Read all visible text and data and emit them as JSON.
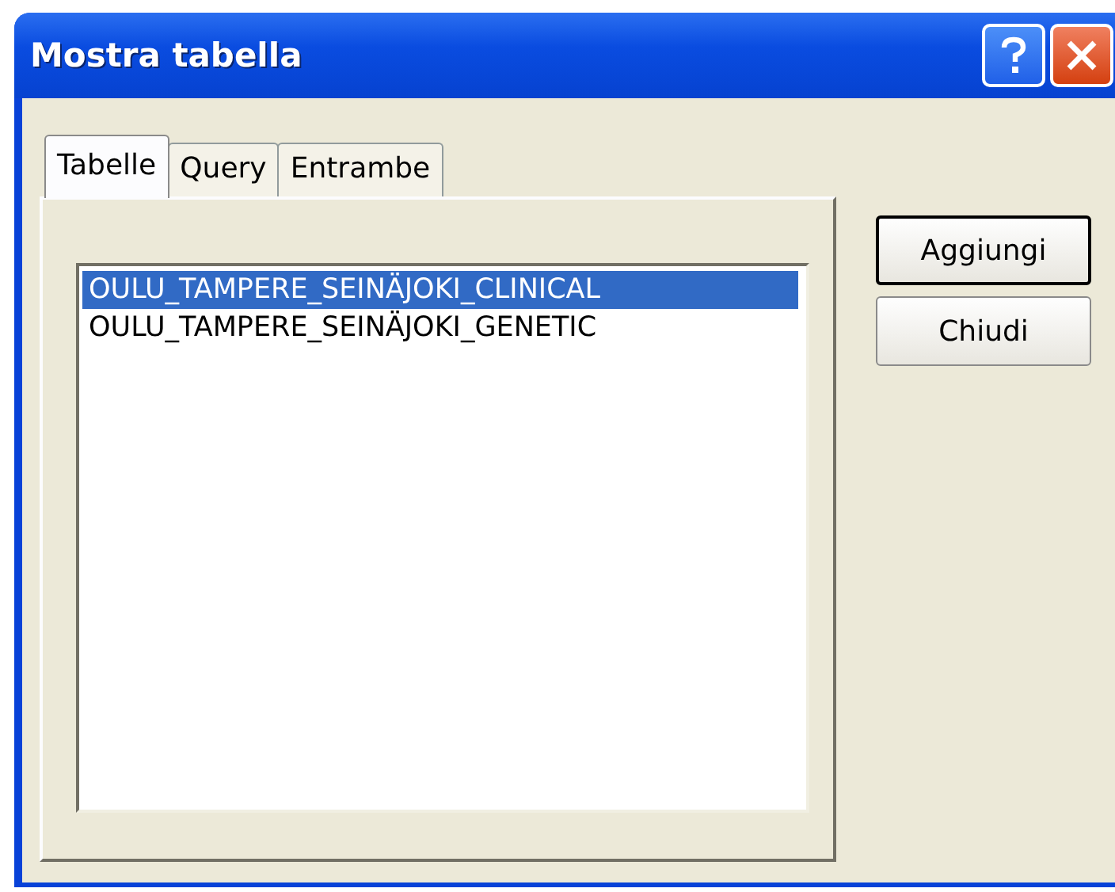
{
  "window": {
    "title": "Mostra tabella"
  },
  "tabs": [
    {
      "label": "Tabelle",
      "selected": true
    },
    {
      "label": "Query",
      "selected": false
    },
    {
      "label": "Entrambe",
      "selected": false
    }
  ],
  "list": [
    {
      "label": "OULU_TAMPERE_SEINÄJOKI_CLINICAL",
      "selected": true
    },
    {
      "label": "OULU_TAMPERE_SEINÄJOKI_GENETIC",
      "selected": false
    }
  ],
  "buttons": [
    {
      "label": "Aggiungi",
      "default": true
    },
    {
      "label": "Chiudi",
      "default": false
    }
  ]
}
